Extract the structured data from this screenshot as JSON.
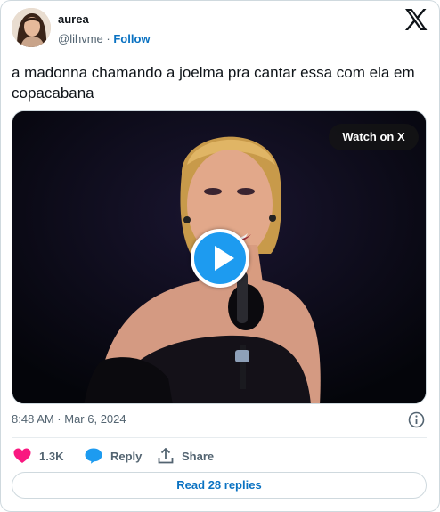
{
  "author": {
    "name": "aurea",
    "handle": "@lihvme",
    "separator": "·",
    "follow_label": "Follow",
    "avatar_icon": "user-avatar"
  },
  "platform": {
    "logo_icon": "x-logo-icon"
  },
  "tweet": {
    "text": "a madonna chamando a joelma pra cantar essa com ela em copacabana"
  },
  "media": {
    "watch_label": "Watch on X",
    "play_icon": "play-icon",
    "accent": "#1d9bf0"
  },
  "meta": {
    "timestamp": "8:48 AM · Mar 6, 2024",
    "info_icon": "info-icon"
  },
  "actions": {
    "like_count": "1.3K",
    "reply_label": "Reply",
    "share_label": "Share",
    "like_color": "#f91880",
    "reply_color": "#1d9bf0"
  },
  "read_replies_label": "Read 28 replies"
}
